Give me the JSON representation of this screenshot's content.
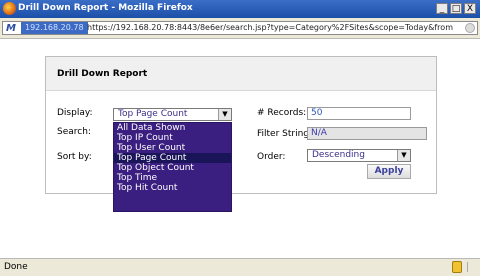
{
  "window": {
    "title": "Drill Down Report - Mozilla Firefox",
    "min": "_",
    "max": "□",
    "close": "X"
  },
  "urlbar": {
    "logo": "M",
    "host": "192.168.20.78",
    "url": "https://192.168.20.78:8443/8e6er/search.jsp?type=Category%2FSites&scope=Today&from"
  },
  "panel": {
    "title": "Drill Down Report",
    "display_label": "Display:",
    "display_value": "Top Page Count",
    "search_label": "Search:",
    "sortby_label": "Sort by:",
    "records_label": "# Records:",
    "records_value": "50",
    "filter_label": "Filter String:",
    "filter_value": "N/A",
    "order_label": "Order:",
    "order_value": "Descending",
    "apply_label": "Apply"
  },
  "dropdown": {
    "options": [
      "All Data Shown",
      "Top IP Count",
      "Top User Count",
      "Top Page Count",
      "Top Object Count",
      "Top Time",
      "Top Hit Count"
    ],
    "selected_index": 3
  },
  "status": {
    "text": "Done"
  },
  "colors": {
    "titlebar": "#1c4fa8",
    "dropdown_bg": "#3b1f80",
    "dropdown_selected": "#1a1458"
  }
}
